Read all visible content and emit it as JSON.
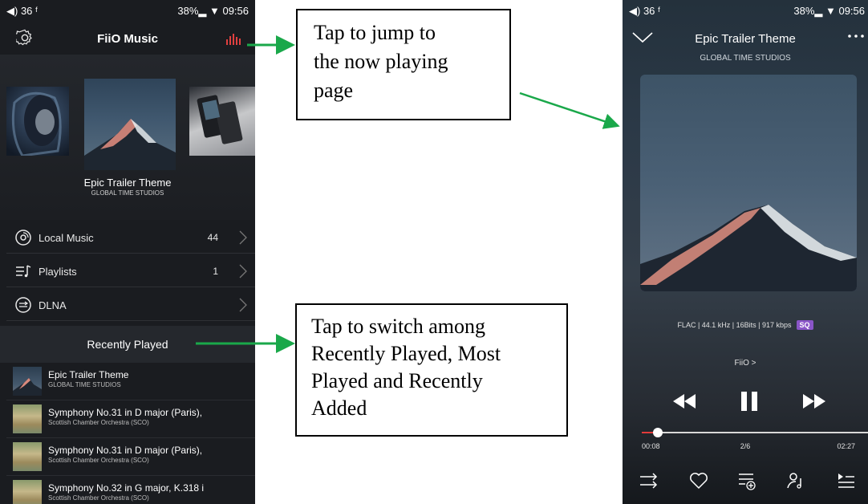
{
  "left_phone": {
    "status": {
      "left": "◀) 36  ᶠ",
      "right": "38%▂ ▼ 09:56"
    },
    "header": {
      "title": "FiiO Music",
      "settings_icon": "gear-icon",
      "now_playing_icon": "equalizer-bars-icon"
    },
    "carousel": {
      "title": "Epic Trailer Theme",
      "artist": "GLOBAL TIME STUDIOS"
    },
    "menu": [
      {
        "label": "Local Music",
        "count": "44",
        "icon": "disc-icon"
      },
      {
        "label": "Playlists",
        "count": "1",
        "icon": "playlist-icon"
      },
      {
        "label": "DLNA",
        "count": "",
        "icon": "dlna-icon"
      }
    ],
    "recently_played": {
      "label": "Recently Played"
    },
    "list": [
      {
        "title": "Epic Trailer Theme",
        "subtitle": "GLOBAL TIME STUDIOS"
      },
      {
        "title": "Symphony No.31 in D major (Paris),",
        "subtitle": "Scottish Chamber Orchestra (SCO)"
      },
      {
        "title": "Symphony No.31 in D major (Paris),",
        "subtitle": "Scottish Chamber Orchestra (SCO)"
      },
      {
        "title": "Symphony No.32 in G major, K.318 i",
        "subtitle": "Scottish Chamber Orchestra (SCO)"
      }
    ]
  },
  "callouts": {
    "c1": [
      "Tap to jump to",
      "the now playing",
      "page"
    ],
    "c2": [
      "Tap to switch among",
      "Recently Played, Most",
      "Played and Recently",
      "Added"
    ],
    "arrow_color": "#1aa84a"
  },
  "right_phone": {
    "status": {
      "left": "◀) 36  ᶠ",
      "right": "38%▂ ▼ 09:56"
    },
    "title": "Epic Trailer Theme",
    "artist": "GLOBAL TIME STUDIOS",
    "format": "FLAC | 44.1 kHz | 16Bits | 917 kbps",
    "quality_badge": "SQ",
    "source": "FiiO  >",
    "time_current": "00:08",
    "track_index": "2/6",
    "time_total": "02:27",
    "progress": 0.06,
    "progress_color": "#e23b3b",
    "badge_color": "#8a55c8"
  }
}
